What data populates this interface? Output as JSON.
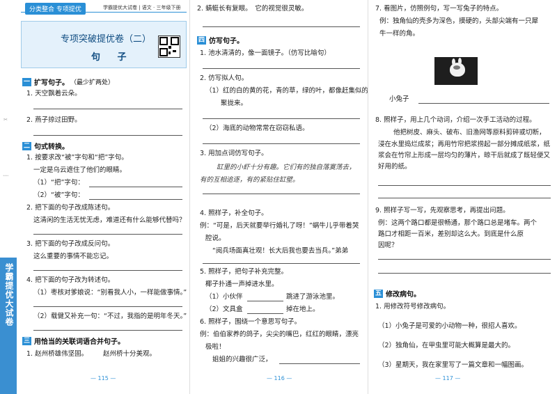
{
  "header": {
    "tag": "分类整合 专项提优",
    "right": "学霸提优大试卷 | 语文 · 三年级下册"
  },
  "title": {
    "main": "专项突破提优卷（二）",
    "sub": "句 子"
  },
  "spine": "学霸提优大试卷",
  "sections": [
    {
      "num": "一",
      "title": "扩写句子。",
      "note": "（最少扩两处）"
    },
    {
      "num": "二",
      "title": "句式转换。"
    },
    {
      "num": "三",
      "title": "用恰当的关联词语合并句子。"
    },
    {
      "num": "四",
      "title": "仿写句子。"
    },
    {
      "num": "五",
      "title": "修改病句。"
    }
  ],
  "p1": {
    "q1": "1. 天空飘着云朵。",
    "q2": "2. 燕子掠过田野。",
    "s2_q1": "1. 按要求改“被”字句和“把”字句。",
    "s2_q1_text": "一定是乌云遮住了他们的眼睛。",
    "s2_q1_a": "（1）“把”字句：",
    "s2_q1_b": "（2）“被”字句：",
    "s2_q2": "2. 把下面的句子改成陈述句。",
    "s2_q2_text": "这清闲的生活无忧无虑，难道还有什么能够代替吗？",
    "s2_q3": "3. 把下面的句子改成反问句。",
    "s2_q3_text": "这么重要的事情不能忘记。",
    "s2_q4": "4. 把下面的句子改为转述句。",
    "s2_q4_a": "（1）枣核对爹娘说：“别看我人小，一样能做事情。”",
    "s2_q4_b": "（2）载健又补充一句：“不过，我指的是明年冬天。”",
    "s3_q1_a": "1. 赵州桥雄伟坚固。",
    "s3_q1_b": "赵州桥十分美观。",
    "page_num": "— 115 —"
  },
  "p2": {
    "q2": "2. 蜻蜓长有复眼。　它的视觉很灵敏。",
    "s4_q1": "1. 池水清清的，像一面镜子。（仿写比喻句）",
    "s4_q2": "2. 仿写拟人句。",
    "s4_q2_a1": "（1）红的白的黄的花，青的草，绿的叶，都像赶集似的",
    "s4_q2_a2": "聚拢来。",
    "s4_q2_b": "（2）海底的动物常常在窃窃私语。",
    "s4_q3": "3. 用加点词仿写句子。",
    "s4_q3_t1": "缸里的小虾十分有趣。它们有的独自落寞荡去，",
    "s4_q3_t2": "有的互相追逐，有的紧贴住缸壁。",
    "s4_q4": "4. 照样子，补全句子。",
    "s4_q4_t1": "例：“可是，后天就要举行婚礼了呀！”蜗牛儿乎带着哭",
    "s4_q4_t2": "腔说。",
    "s4_q4_t3": "“阅兵场面真壮观！长大后我也要去当兵。”弟弟",
    "s4_q5": "5. 照样子，把句子补充完整。",
    "s4_q5_ex": "椰子扑通一声掉进水里。",
    "s4_q5_a1": "（1）小伙伴",
    "s4_q5_a2": "跳进了游泳池里。",
    "s4_q5_b1": "（2）文具盒",
    "s4_q5_b2": "掉在地上。",
    "s4_q6": "6. 照样子，围绕一个意思写句子。",
    "s4_q6_t1": "例：伯伯家养的鸽子，尖尖的嘴巴，红红的眼睛，漂亮",
    "s4_q6_t2": "极啦！",
    "s4_q6_t3": "姐姐的兴趣很广泛，",
    "page_num": "— 116 —"
  },
  "p3": {
    "q7": "7. 看图片，仿照例句，写一写兔子的特点。",
    "q7_t1": "例：独角仙的壳多为深色，摸硬的，头部尖端有一只犀",
    "q7_t2": "牛一样的角。",
    "q7_fill": "小兔子",
    "q8": "8. 照样子，用上几个动词，介绍一次手工活动的过程。",
    "q8_t1": "他把树皮、麻头、破布、旧渔网等原料剪碎或切断，",
    "q8_t2": "浸在水里捣烂成浆；再用竹帘把浆捞起一部分摊成纸浆，纸浆会",
    "q8_t3": "在竹帘上形成一层均匀的薄片，晾干后就成了既轻便又好用的纸。",
    "q9": "9. 照样子写一写，先观察思考，再提出问题。",
    "q9_t1": "例：这两个路口都是很畅通，那个路口总是堵车。两个",
    "q9_t2": "路口才相距一百米，差别却这么大。到底是什么原",
    "q9_t3": "因呢？",
    "s5_q1": "1. 用修改符号修改病句。",
    "s5_q1_a": "（1）小兔子是可爱的小动物一种，很招人喜欢。",
    "s5_q1_b": "（2）独角仙，在甲虫里可能大概算是最大的。",
    "s5_q1_c": "（3）星期天，我在家里写了一篇文章和一幅图画。",
    "page_num": "— 117 —"
  },
  "colors": {
    "accent": "#2a8fd6",
    "title_bg": "#e4f1fb",
    "spine": "#3a8fd1"
  }
}
